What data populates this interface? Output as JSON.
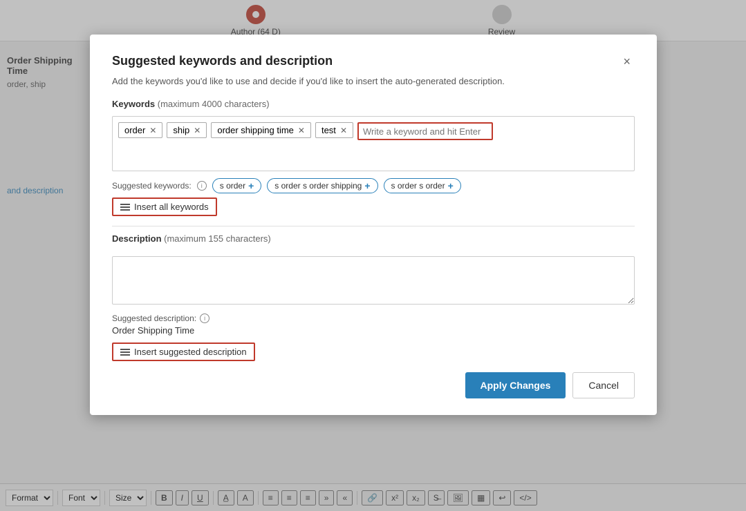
{
  "background": {
    "top_bar": {
      "step1_label": "Author (64 D)",
      "step2_label": "Review"
    },
    "left_panel": {
      "title": "Order Shipping Time",
      "subtitle": "order, ship",
      "link_text": "and description"
    },
    "toolbar": {
      "format_label": "rmat",
      "font_label": "Font",
      "size_label": "Size",
      "bold": "B",
      "italic": "I",
      "underline": "U"
    }
  },
  "modal": {
    "title": "Suggested keywords and description",
    "subtitle": "Add the keywords you'd like to use and decide if you'd like to insert the auto-generated description.",
    "keywords_section": {
      "label": "Keywords",
      "max_chars": "(maximum 4000 characters)",
      "tags": [
        {
          "text": "order"
        },
        {
          "text": "ship"
        },
        {
          "text": "order shipping time"
        },
        {
          "text": "test"
        }
      ],
      "input_placeholder": "Write a keyword and hit Enter",
      "suggested_label": "Suggested keywords:",
      "suggested_chips": [
        {
          "text": "s order"
        },
        {
          "text": "s order s order shipping"
        },
        {
          "text": "s order s order"
        }
      ],
      "insert_all_label": "Insert all keywords"
    },
    "description_section": {
      "label": "Description",
      "max_chars": "(maximum 155 characters)",
      "placeholder": "",
      "suggested_label": "Suggested description:",
      "suggested_value": "Order Shipping Time",
      "insert_suggested_label": "Insert suggested description"
    },
    "footer": {
      "apply_label": "Apply Changes",
      "cancel_label": "Cancel"
    }
  }
}
